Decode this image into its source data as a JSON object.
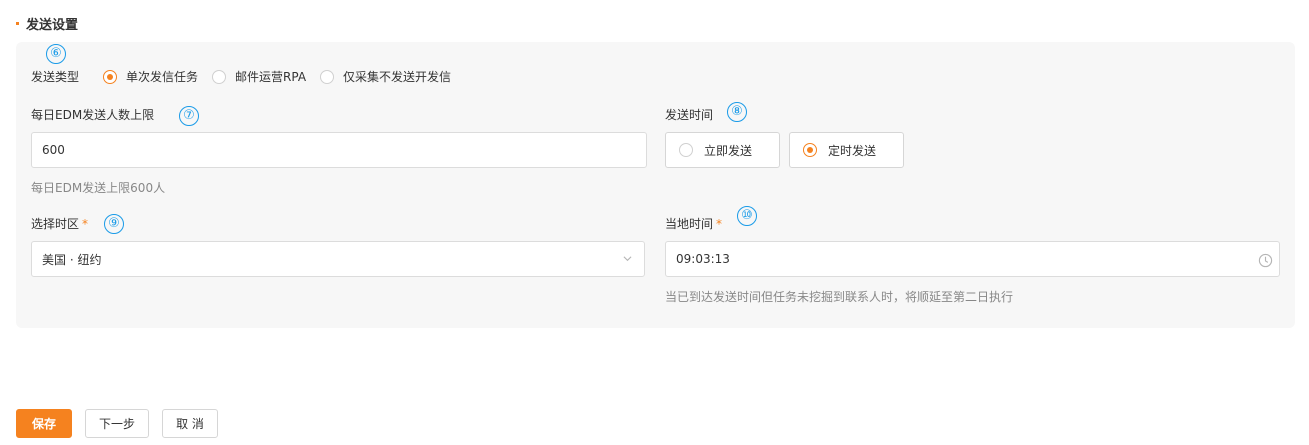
{
  "section": {
    "title": "发送设置"
  },
  "annotations": {
    "a6": "⑥",
    "a7": "⑦",
    "a8": "⑧",
    "a9": "⑨",
    "a10": "⑩"
  },
  "send_type": {
    "label": "发送类型",
    "options": [
      {
        "label": "单次发信任务",
        "checked": true
      },
      {
        "label": "邮件运营RPA",
        "checked": false
      },
      {
        "label": "仅采集不发送开发信",
        "checked": false
      }
    ]
  },
  "daily_limit": {
    "label": "每日EDM发送人数上限",
    "value": "600",
    "hint": "每日EDM发送上限600人"
  },
  "send_time": {
    "label": "发送时间",
    "options": [
      {
        "label": "立即发送",
        "checked": false
      },
      {
        "label": "定时发送",
        "checked": true
      }
    ]
  },
  "timezone": {
    "label": "选择时区",
    "required_mark": "*",
    "value": "美国 · 纽约"
  },
  "local_time": {
    "label": "当地时间",
    "required_mark": "*",
    "value": "09:03:13",
    "hint": "当已到达发送时间但任务未挖掘到联系人时，将顺延至第二日执行"
  },
  "footer": {
    "save": "保存",
    "next": "下一步",
    "cancel": "取 消"
  },
  "colors": {
    "accent": "#f5821f",
    "annotation": "#1a9be8",
    "panel_bg": "#f7f7f7"
  }
}
